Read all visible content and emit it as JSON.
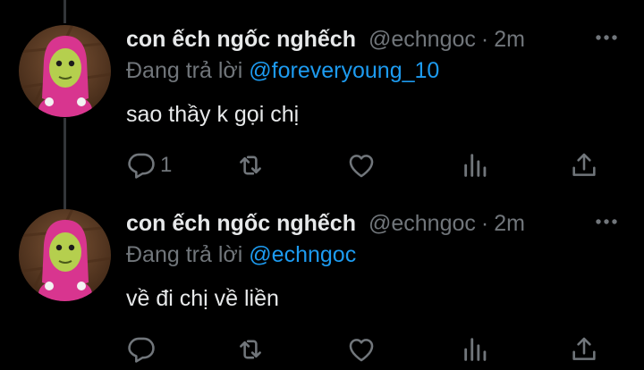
{
  "colors": {
    "background": "#000000",
    "text": "#e7e9ea",
    "secondary": "#71767b",
    "link": "#1d9bf0",
    "thread_line": "#333639"
  },
  "tweets": [
    {
      "display_name": "con ếch ngốc nghếch",
      "handle": "@echngoc",
      "separator": "·",
      "time": "2m",
      "reply_prefix": "Đang trả lời",
      "reply_to": "@foreveryoung_10",
      "text": "sao thầy k gọi chị",
      "reply_count": "1",
      "icons": [
        "more-icon",
        "reply-icon",
        "retweet-icon",
        "like-icon",
        "views-icon",
        "share-icon"
      ]
    },
    {
      "display_name": "con ếch ngốc nghếch",
      "handle": "@echngoc",
      "separator": "·",
      "time": "2m",
      "reply_prefix": "Đang trả lời",
      "reply_to": "@echngoc",
      "text": "về đi chị về liền",
      "reply_count": "",
      "icons": [
        "more-icon",
        "reply-icon",
        "retweet-icon",
        "like-icon",
        "views-icon",
        "share-icon"
      ]
    }
  ]
}
